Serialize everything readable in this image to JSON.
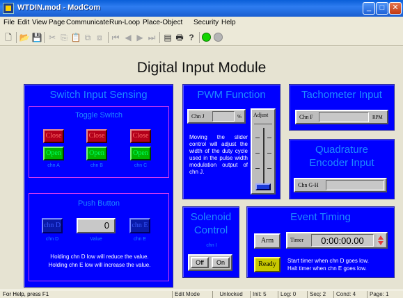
{
  "window": {
    "title": "WTDIN.mod - ModCom"
  },
  "menu": [
    "File",
    "Edit",
    "View",
    "Page",
    "Communicate",
    "Run-Loop",
    "Place-Object",
    "Security",
    "Help"
  ],
  "heading": "Digital Input Module",
  "switch_panel": {
    "title": "Switch Input Sensing",
    "toggle": {
      "title": "Toggle Switch",
      "close_label": "Close",
      "open_label": "Open",
      "channels": [
        "chn A",
        "chn B",
        "chn C"
      ]
    },
    "push": {
      "title": "Push Button",
      "left_label": "chn D",
      "right_label": "chn E",
      "value_label": "Value",
      "value": "0",
      "note_line1": "Holding chn D low will reduce the value.",
      "note_line2": "Holding chn E low will increase the value."
    }
  },
  "pwm": {
    "title": "PWM Function",
    "field_label": "Chn J",
    "unit": "%",
    "adjust_label": "Adjust",
    "description": "Moving the slider control will adjust the width of the duty cycle used in the pulse width modulation output of chn J."
  },
  "tach": {
    "title": "Tachometer Input",
    "field_label": "Chn F",
    "unit": "RPM"
  },
  "quad": {
    "title_line1": "Quadrature",
    "title_line2": "Encoder Input",
    "field_label": "Chn G-H"
  },
  "solenoid": {
    "title_line1": "Solenoid",
    "title_line2": "Control",
    "channel": "chn I",
    "off_label": "Off",
    "on_label": "On"
  },
  "event": {
    "title": "Event Timing",
    "arm_label": "Arm",
    "ready_label": "Ready",
    "timer_label": "Timer",
    "timer_value": "0:00:00.00",
    "note_line1": "Start timer when chn D goes low.",
    "note_line2": "Halt timer when chn E goes low."
  },
  "status": {
    "help": "For Help, press F1",
    "mode": "Edit Mode",
    "lock": "Unlocked",
    "init": "Init: 5",
    "log": "Log: 0",
    "seq": "Seq: 2",
    "cond": "Cond: 4",
    "page": "Page: 1"
  },
  "colors": {
    "panel": "#0000ff",
    "panel_title": "#1e8bff",
    "inner_border": "#d23cf0"
  }
}
